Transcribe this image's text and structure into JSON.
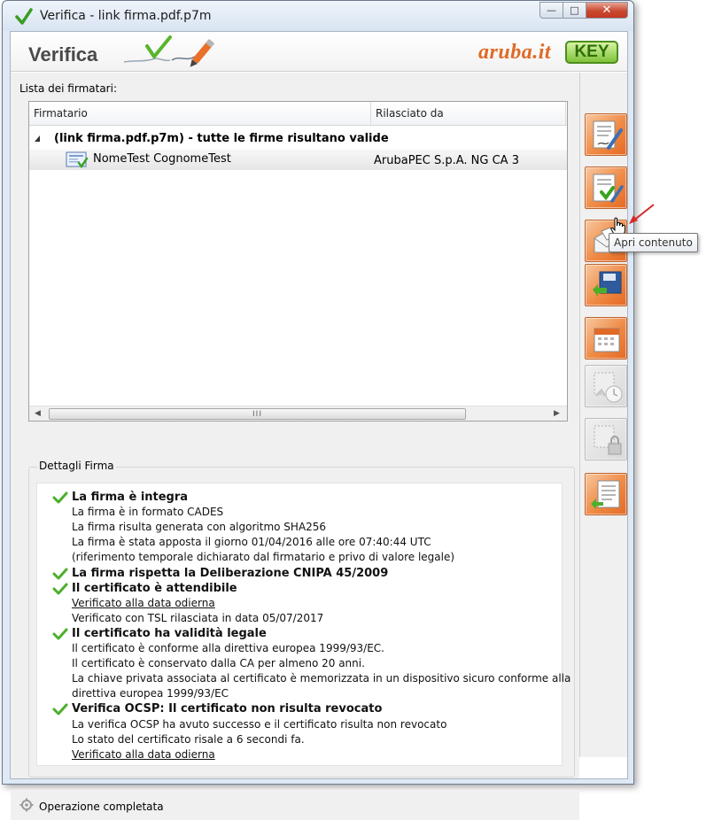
{
  "window": {
    "title": "Verifica - link firma.pdf.p7m",
    "minimize_glyph": "—",
    "maximize_glyph": "□",
    "close_glyph": "✕"
  },
  "banner": {
    "title": "Verifica",
    "logo_brand": "aruba.it",
    "logo_key": "KEY"
  },
  "signers": {
    "label": "Lista dei firmatari:",
    "columns": [
      "Firmatario",
      "Rilasciato da"
    ],
    "group_text": "(link firma.pdf.p7m)  - tutte le firme risultano valide",
    "rows": [
      {
        "name": "NomeTest CognomeTest",
        "issuer": "ArubaPEC S.p.A. NG CA 3"
      }
    ],
    "scroll_left": "◀",
    "scroll_right": "▶",
    "scroll_grip": "III"
  },
  "details": {
    "label": "Dettagli Firma",
    "lines": [
      {
        "type": "head",
        "text": "La firma è integra"
      },
      {
        "type": "text",
        "text": "La firma è in formato CADES"
      },
      {
        "type": "text",
        "text": "La firma risulta generata con algoritmo SHA256"
      },
      {
        "type": "text",
        "text": "La firma è stata apposta il giorno 01/04/2016 alle ore 07:40:44 UTC"
      },
      {
        "type": "text",
        "text": "(riferimento temporale dichiarato dal firmatario e privo di valore legale)"
      },
      {
        "type": "head",
        "text": "La firma rispetta la Deliberazione CNIPA 45/2009"
      },
      {
        "type": "head",
        "text": "Il certificato è attendibile"
      },
      {
        "type": "link",
        "text": "Verificato alla data odierna"
      },
      {
        "type": "text",
        "text": "Verificato con TSL rilasciata in data 05/07/2017"
      },
      {
        "type": "head",
        "text": "Il certificato ha validità legale"
      },
      {
        "type": "text",
        "text": "Il certificato è conforme alla direttiva europea 1999/93/EC."
      },
      {
        "type": "text",
        "text": "Il certificato è conservato dalla CA per almeno 20 anni."
      },
      {
        "type": "text",
        "text": "La chiave privata associata al certificato è memorizzata in un dispositivo sicuro conforme alla"
      },
      {
        "type": "text",
        "text": "direttiva europea 1999/93/EC"
      },
      {
        "type": "head",
        "text": "Verifica OCSP: Il certificato non risulta revocato"
      },
      {
        "type": "text",
        "text": "La verifica OCSP ha avuto successo e il certificato risulta non revocato"
      },
      {
        "type": "text",
        "text": "Lo stato del certificato risale a 6 secondi fa."
      },
      {
        "type": "link",
        "text": "Verificato alla data odierna"
      }
    ]
  },
  "status": {
    "text": "Operazione completata"
  },
  "tooltip": {
    "text": "Apri contenuto"
  },
  "colors": {
    "accent_orange": "#ef8a45",
    "check_green": "#4caf2a",
    "close_red": "#c9482e"
  }
}
